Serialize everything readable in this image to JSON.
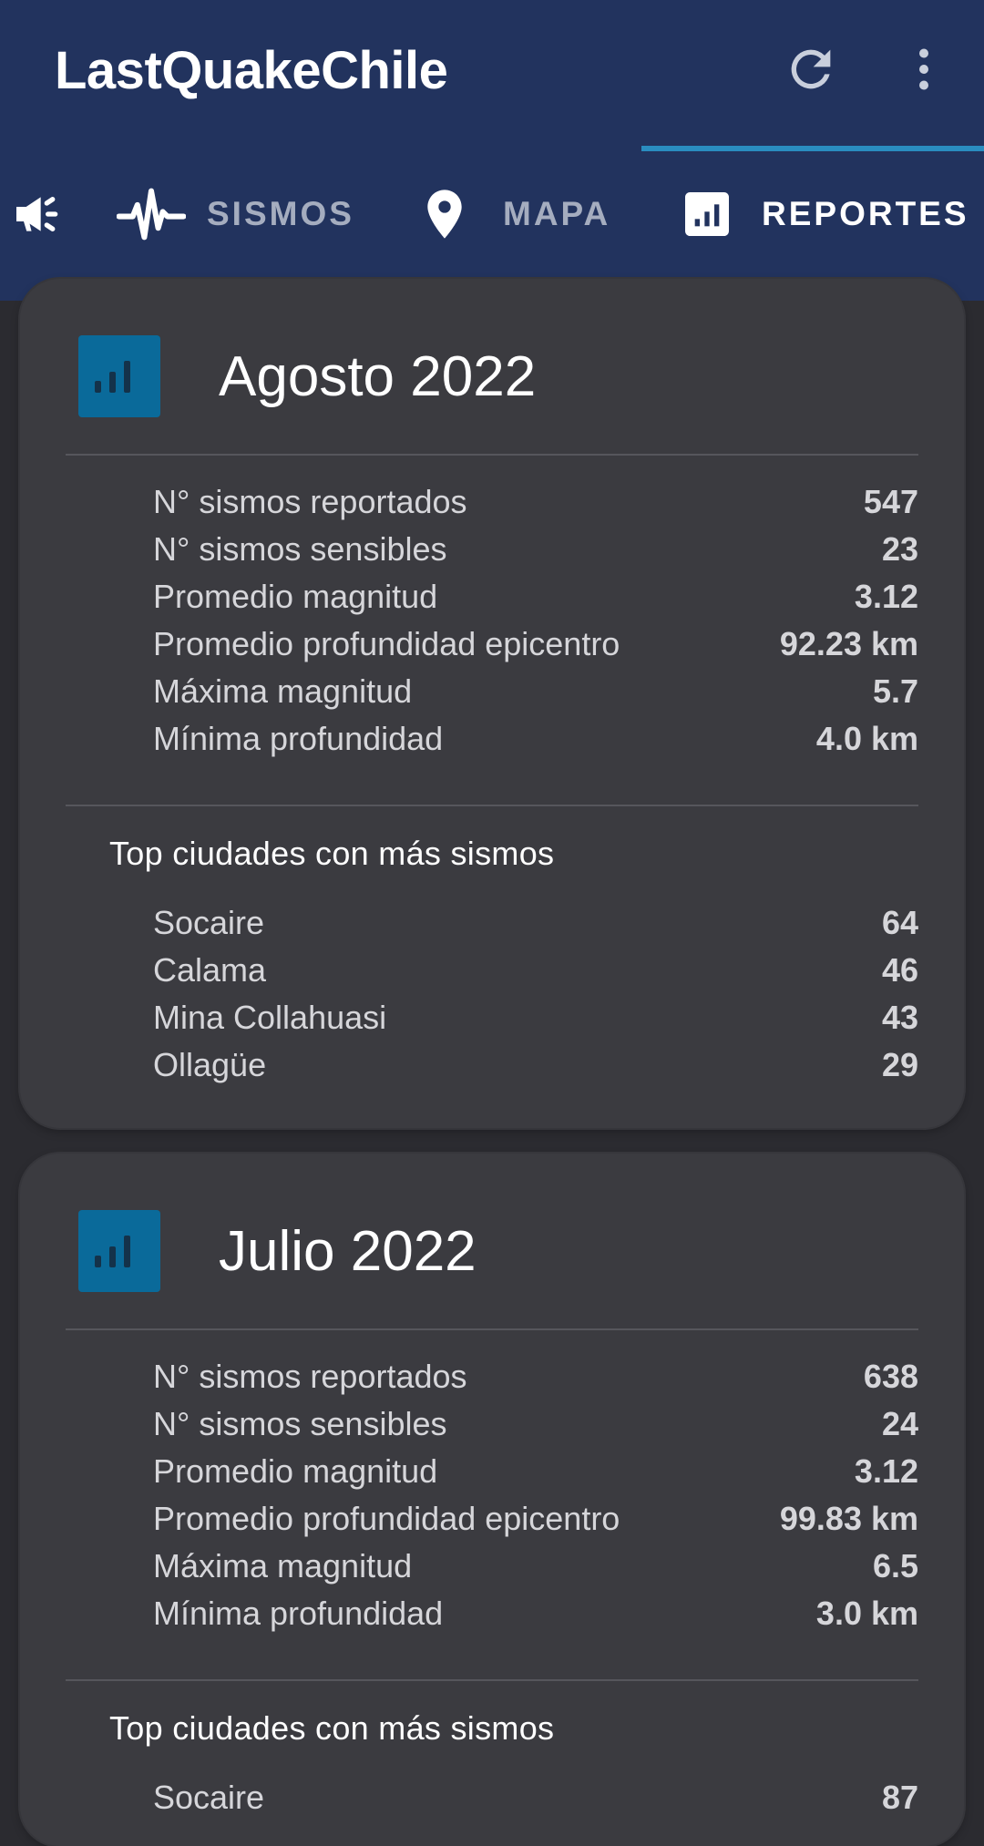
{
  "app": {
    "title": "LastQuakeChile",
    "refresh_icon": "refresh-icon",
    "more_icon": "more-vert-icon"
  },
  "tabs": [
    {
      "label": "",
      "icon": "megaphone-icon",
      "active": false
    },
    {
      "label": "SISMOS",
      "icon": "waveform-icon",
      "active": false
    },
    {
      "label": "MAPA",
      "icon": "location-pin-icon",
      "active": false
    },
    {
      "label": "REPORTES",
      "icon": "bar-chart-icon",
      "active": true
    }
  ],
  "colors": {
    "appbar": "#22335e",
    "tab_indicator": "#2a8dc0",
    "card_icon": "#0a6a9a",
    "card_background": "#3b3b40",
    "page_background": "#2b2b30"
  },
  "reports": [
    {
      "title": "Agosto 2022",
      "stats": [
        {
          "label": "N° sismos reportados",
          "value": "547"
        },
        {
          "label": "N° sismos sensibles",
          "value": "23"
        },
        {
          "label": "Promedio magnitud",
          "value": "3.12"
        },
        {
          "label": "Promedio profundidad epicentro",
          "value": "92.23 km"
        },
        {
          "label": "Máxima magnitud",
          "value": "5.7"
        },
        {
          "label": "Mínima profundidad",
          "value": "4.0 km"
        }
      ],
      "top_title": "Top ciudades con más sismos",
      "top_cities": [
        {
          "name": "Socaire",
          "count": "64"
        },
        {
          "name": "Calama",
          "count": "46"
        },
        {
          "name": "Mina Collahuasi",
          "count": "43"
        },
        {
          "name": "Ollagüe",
          "count": "29"
        }
      ]
    },
    {
      "title": "Julio 2022",
      "stats": [
        {
          "label": "N° sismos reportados",
          "value": "638"
        },
        {
          "label": "N° sismos sensibles",
          "value": "24"
        },
        {
          "label": "Promedio magnitud",
          "value": "3.12"
        },
        {
          "label": "Promedio profundidad epicentro",
          "value": "99.83 km"
        },
        {
          "label": "Máxima magnitud",
          "value": "6.5"
        },
        {
          "label": "Mínima profundidad",
          "value": "3.0 km"
        }
      ],
      "top_title": "Top ciudades con más sismos",
      "top_cities": [
        {
          "name": "Socaire",
          "count": "87"
        }
      ]
    }
  ]
}
